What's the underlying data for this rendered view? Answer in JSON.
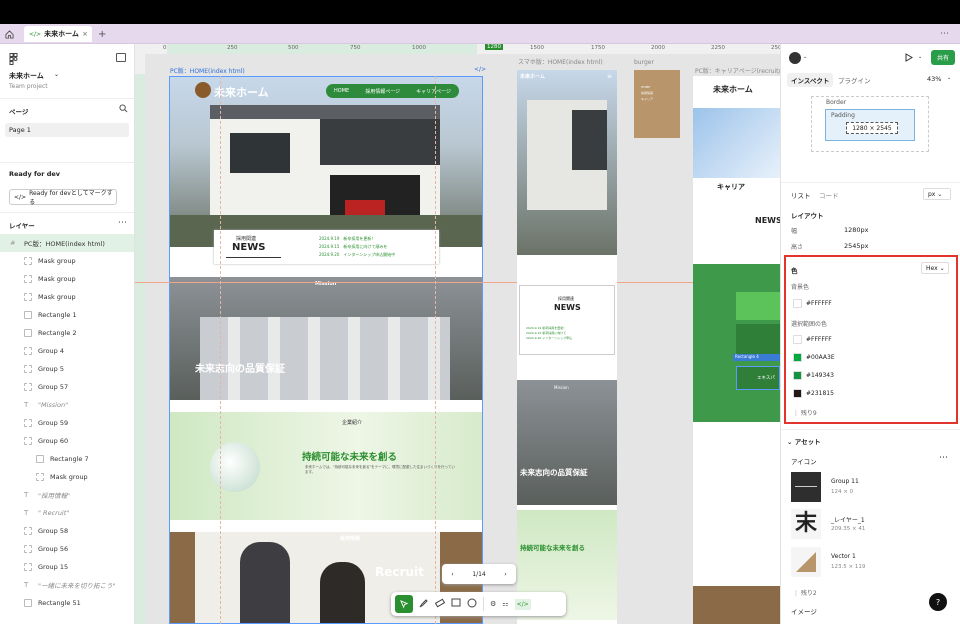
{
  "tabs": {
    "home_icon": "home-icon",
    "file_tab": "未来ホーム",
    "add": "+",
    "more": "⋯"
  },
  "left": {
    "project_name": "未来ホーム",
    "project_team": "Team project",
    "pages_heading": "ページ",
    "page_item": "Page 1",
    "ready_heading": "Ready for dev",
    "ready_button": "Ready for devとしてマークする",
    "layers_heading": "レイヤー",
    "layers": [
      {
        "label": "PC版：HOME(index html)",
        "kind": "frame"
      },
      {
        "label": "Mask group",
        "kind": "group"
      },
      {
        "label": "Mask group",
        "kind": "group"
      },
      {
        "label": "Mask group",
        "kind": "group"
      },
      {
        "label": "Rectangle 1",
        "kind": "rect"
      },
      {
        "label": "Rectangle 2",
        "kind": "rect"
      },
      {
        "label": "Group 4",
        "kind": "group"
      },
      {
        "label": "Group 5",
        "kind": "group"
      },
      {
        "label": "Group 57",
        "kind": "group"
      },
      {
        "label": "\"Mission\"",
        "kind": "text"
      },
      {
        "label": "Group 59",
        "kind": "group"
      },
      {
        "label": "Group 60",
        "kind": "group"
      },
      {
        "label": "Rectangle 7",
        "kind": "rect"
      },
      {
        "label": "Mask group",
        "kind": "group"
      },
      {
        "label": "\"採用情報\"",
        "kind": "text"
      },
      {
        "label": "\" Recruit\"",
        "kind": "text"
      },
      {
        "label": "Group 58",
        "kind": "group"
      },
      {
        "label": "Group 56",
        "kind": "group"
      },
      {
        "label": "Group 15",
        "kind": "group"
      },
      {
        "label": "\"一緒に未来を切り拓こう\"",
        "kind": "text"
      },
      {
        "label": "Rectangle 51",
        "kind": "rect"
      }
    ]
  },
  "canvas": {
    "ruler": [
      "0",
      "250",
      "500",
      "750",
      "1000",
      "1280",
      "1500",
      "1750",
      "2000",
      "2250",
      "2500"
    ],
    "frame_pc_label": "PC版：HOME(index html)",
    "frame_sp_label": "スマホ版：HOME(index html)",
    "frame_burger_label": "burger",
    "frame_career_label": "PC版：キャリアページ(recruit/)",
    "pc": {
      "logo": "未来ホーム",
      "nav": [
        "HOME",
        "採用情報ページ",
        "キャリアページ"
      ],
      "news_sub": "採用関連",
      "news_title": "NEWS",
      "news_rows": [
        "2024.9.19　新卒採用を更新！",
        "2024.9.15　新卒採用に向けて頑みを",
        "2024.9.20　インターンシップ申込開始中"
      ],
      "mission_label": "Mission",
      "mission_text": "未来志向の品質保証",
      "company_label": "企業紹介",
      "company_title": "持続可能な未来を創る",
      "company_body": "未来ホームでは、\"持続可能な未来を創る\"をテーマに、環境に配慮した住まいづくりを行っています。",
      "recruit_label": "採用情報",
      "recruit_title": "Recruit"
    },
    "sp": {
      "logo": "未来ホーム",
      "news_sub": "採用関連",
      "news_title": "NEWS",
      "mission_label": "Mission",
      "mission_text": "未来志向の品質保証",
      "company_title": "持続可能な未来を創る"
    },
    "career": {
      "logo": "未来ホーム",
      "title": "キャリア",
      "news_title": "NEWS",
      "rect_label": "Rectangle 4",
      "btn": "エキスパ"
    },
    "pagination": {
      "current": "1/14",
      "prev": "‹",
      "next": "›"
    },
    "toolbar": [
      "move",
      "pen",
      "ruler",
      "comment",
      "bubble",
      "plugin",
      "dev",
      "code"
    ]
  },
  "right": {
    "share": "共有",
    "tab_inspect": "インスペクト",
    "tab_plugin": "プラグイン",
    "zoom": "43%",
    "border_label": "Border",
    "padding_label": "Padding",
    "size": "1280 × 2545",
    "list_tab": "リスト",
    "code_tab": "コード",
    "unit": "px",
    "layout_heading": "レイアウト",
    "width_label": "幅",
    "width_value": "1280px",
    "height_label": "高さ",
    "height_value": "2545px",
    "color_heading": "色",
    "color_format": "Hex",
    "bg_label": "背景色",
    "bg_value": "#FFFFFF",
    "sel_label": "選択範囲の色",
    "colors": [
      {
        "hex": "#FFFFFF"
      },
      {
        "hex": "#00AA3E"
      },
      {
        "hex": "#149343"
      },
      {
        "hex": "#231815"
      }
    ],
    "remaining": "残り9",
    "asset_heading": "アセット",
    "icon_heading": "アイコン",
    "assets": [
      {
        "name": "Group 11",
        "size": "124 × 0"
      },
      {
        "name": "_レイヤー_1",
        "size": "209.35 × 41"
      },
      {
        "name": "Vector 1",
        "size": "123.5 × 119"
      }
    ],
    "asset_remaining": "残り2",
    "image_heading": "イメージ",
    "help": "?"
  }
}
